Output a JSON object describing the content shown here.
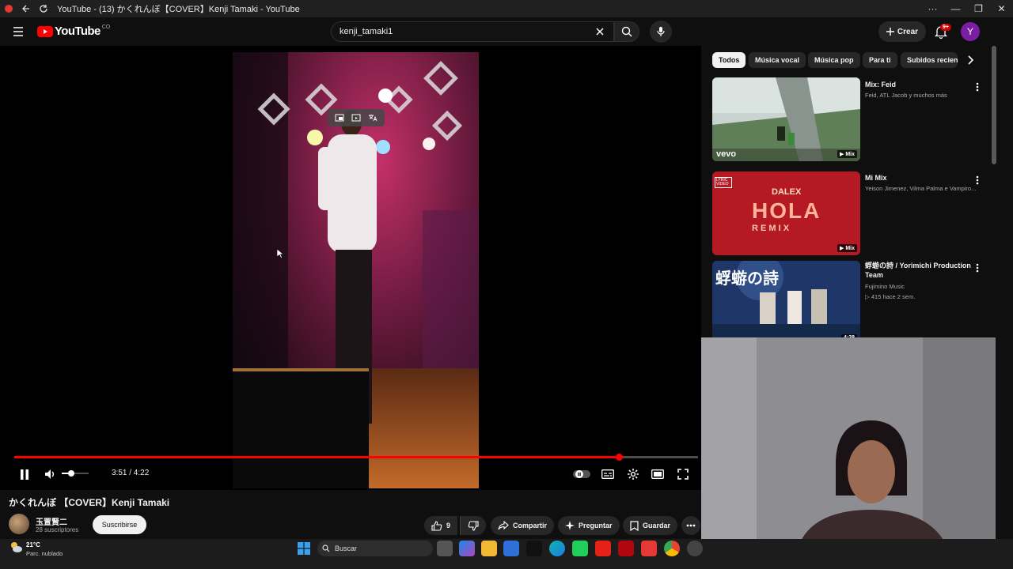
{
  "browser": {
    "tab_title": "YouTube - (13) かくれんぼ【COVER】Kenji Tamaki - YouTube",
    "controls": {
      "more": "···",
      "minimize": "—",
      "restore": "❐",
      "close": "✕"
    }
  },
  "masthead": {
    "logo_text": "YouTube",
    "country_code": "CO",
    "search_value": "kenji_tamaki1",
    "create_label": "Crear",
    "notification_badge": "9+",
    "avatar_letter": "Y"
  },
  "player": {
    "time_display": "3:51 / 4:22",
    "progress": 0.884,
    "volume": 0.35
  },
  "video": {
    "title": "かくれんぼ 【COVER】Kenji Tamaki",
    "channel_name": "玉置賢二",
    "subscribers": "28 suscriptores",
    "subscribe_label": "Suscribirse",
    "like_count": "9",
    "share_label": "Compartir",
    "ask_label": "Preguntar",
    "save_label": "Guardar"
  },
  "chips": [
    "Todos",
    "Música vocal",
    "Música pop",
    "Para ti",
    "Subidos recien"
  ],
  "recommendations": [
    {
      "title": "Mix: Feid",
      "subtitle": "Feid, ATL Jacob y muchos más",
      "stats": "",
      "tag": "Mix",
      "thumb_brand": "vevo"
    },
    {
      "title": "Mi Mix",
      "subtitle": "Yeison Jimenez, Vilma Palma e Vampiro...",
      "stats": "",
      "tag": "Mix",
      "thumb_text_1": "DALEX",
      "thumb_text_2": "HOLA",
      "thumb_text_3": "R E M I X",
      "thumb_badge": "LYRIC VIDEO"
    },
    {
      "title": "蜉蝣の詩 / Yorimichi Production Team",
      "subtitle": "Fujimino Music",
      "stats": "▷ 415  hace 2 sem.",
      "tag": "4:28",
      "thumb_text_1": "蜉蝣の詩"
    }
  ],
  "taskbar": {
    "temperature": "21°C",
    "weather": "Parc. nublado",
    "search_placeholder": "Buscar"
  },
  "colors": {
    "accent_red": "#ff0000",
    "background": "#0f0f0f",
    "chip_bg": "#272727"
  }
}
